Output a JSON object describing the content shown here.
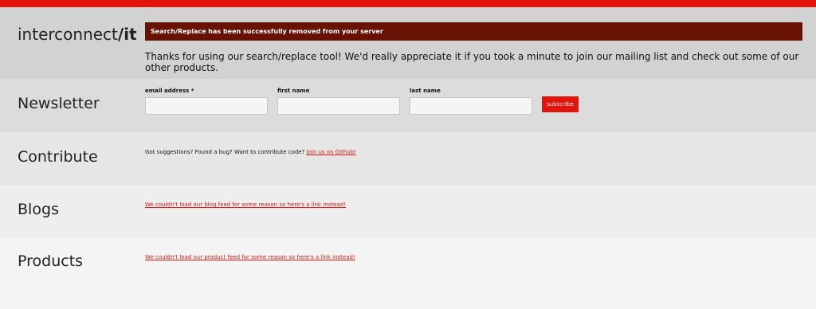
{
  "header": {
    "brand_prefix": "interconnect",
    "brand_slash": "/",
    "brand_suffix": "it",
    "notice": "Search/Replace has been successfully removed from your server",
    "thanks": "Thanks for using our search/replace tool! We'd really appreciate it if you took a minute to join our mailing list and check out some of our other products."
  },
  "newsletter": {
    "title": "Newsletter",
    "email_label": "email address *",
    "email_value": "",
    "first_label": "first name",
    "first_value": "",
    "last_label": "last name",
    "last_value": "",
    "subscribe_label": "subscribe"
  },
  "contribute": {
    "title": "Contribute",
    "text": "Got suggestions? Found a bug? Want to contribute code?",
    "link": "Join us on Github!"
  },
  "blogs": {
    "title": "Blogs",
    "link": "We couldn't load our blog feed for some reason so here's a link instead!"
  },
  "products": {
    "title": "Products",
    "link": "We couldn't load our product feed for some reason so here's a link instead!"
  },
  "colors": {
    "accent": "#e2140c",
    "notice_bg": "#681203"
  }
}
